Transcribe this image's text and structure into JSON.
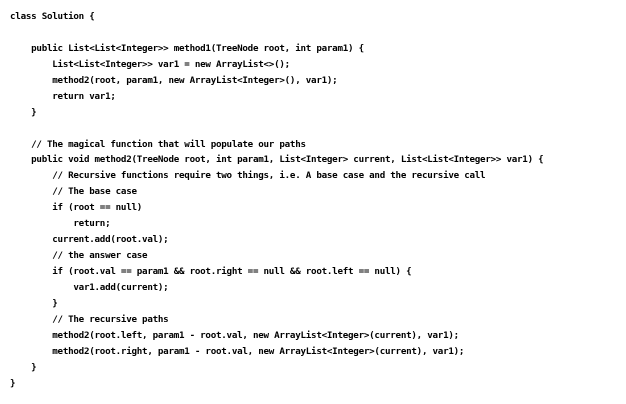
{
  "code": {
    "lines": [
      "class Solution {",
      "",
      "    public List<List<Integer>> method1(TreeNode root, int param1) {",
      "        List<List<Integer>> var1 = new ArrayList<>();",
      "        method2(root, param1, new ArrayList<Integer>(), var1);",
      "        return var1;",
      "    }",
      "",
      "    // The magical function that will populate our paths",
      "    public void method2(TreeNode root, int param1, List<Integer> current, List<List<Integer>> var1) {",
      "        // Recursive functions require two things, i.e. A base case and the recursive call",
      "        // The base case",
      "        if (root == null)",
      "            return;",
      "        current.add(root.val);",
      "        // the answer case",
      "        if (root.val == param1 && root.right == null && root.left == null) {",
      "            var1.add(current);",
      "        }",
      "        // The recursive paths",
      "        method2(root.left, param1 - root.val, new ArrayList<Integer>(current), var1);",
      "        method2(root.right, param1 - root.val, new ArrayList<Integer>(current), var1);",
      "    }",
      "}"
    ]
  }
}
